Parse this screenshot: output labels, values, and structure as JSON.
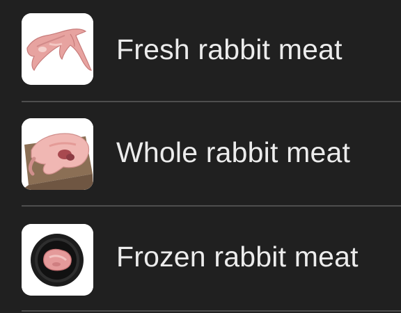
{
  "list": {
    "items": [
      {
        "label": "Fresh rabbit meat",
        "icon": "fresh-rabbit-meat-icon"
      },
      {
        "label": "Whole rabbit meat",
        "icon": "whole-rabbit-meat-icon"
      },
      {
        "label": "Frozen rabbit meat",
        "icon": "frozen-rabbit-meat-icon"
      }
    ]
  },
  "colors": {
    "background": "#202020",
    "text": "#ececec",
    "divider": "#4e4e4e",
    "thumb_background": "#ffffff"
  }
}
